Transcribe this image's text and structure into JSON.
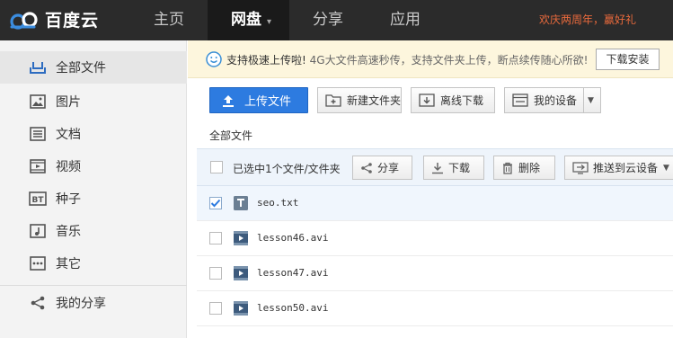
{
  "brand": {
    "name": "百度云"
  },
  "nav": {
    "items": [
      {
        "label": "主页"
      },
      {
        "label": "网盘",
        "active": true
      },
      {
        "label": "分享"
      },
      {
        "label": "应用"
      }
    ],
    "promo": "欢庆两周年，赢好礼"
  },
  "sidebar": {
    "items": [
      {
        "label": "全部文件",
        "icon": "all-files-icon",
        "active": true
      },
      {
        "label": "图片",
        "icon": "image-icon"
      },
      {
        "label": "文档",
        "icon": "document-icon"
      },
      {
        "label": "视频",
        "icon": "video-icon"
      },
      {
        "label": "种子",
        "icon": "torrent-icon"
      },
      {
        "label": "音乐",
        "icon": "music-icon"
      },
      {
        "label": "其它",
        "icon": "other-icon"
      }
    ],
    "share": {
      "label": "我的分享",
      "icon": "share-icon"
    }
  },
  "notice": {
    "lead": "支持极速上传啦!",
    "text": "4G大文件高速秒传，支持文件夹上传，断点续传随心所欲!",
    "button": "下载安装"
  },
  "toolbar": {
    "upload": "上传文件",
    "new_folder": "新建文件夹",
    "offline": "离线下载",
    "devices": "我的设备"
  },
  "breadcrumb": "全部文件",
  "selection": {
    "label": "已选中1个文件/文件夹",
    "share": "分享",
    "download": "下载",
    "delete": "删除",
    "push": "推送到云设备"
  },
  "files": [
    {
      "name": "seo.txt",
      "type": "txt",
      "checked": true
    },
    {
      "name": "lesson46.avi",
      "type": "video",
      "checked": false
    },
    {
      "name": "lesson47.avi",
      "type": "video",
      "checked": false
    },
    {
      "name": "lesson50.avi",
      "type": "video",
      "checked": false
    }
  ],
  "colors": {
    "accent": "#2d7be0",
    "topbar": "#2b2b2b",
    "promo": "#e96a3c",
    "notice_bg": "#fdf6dd"
  }
}
